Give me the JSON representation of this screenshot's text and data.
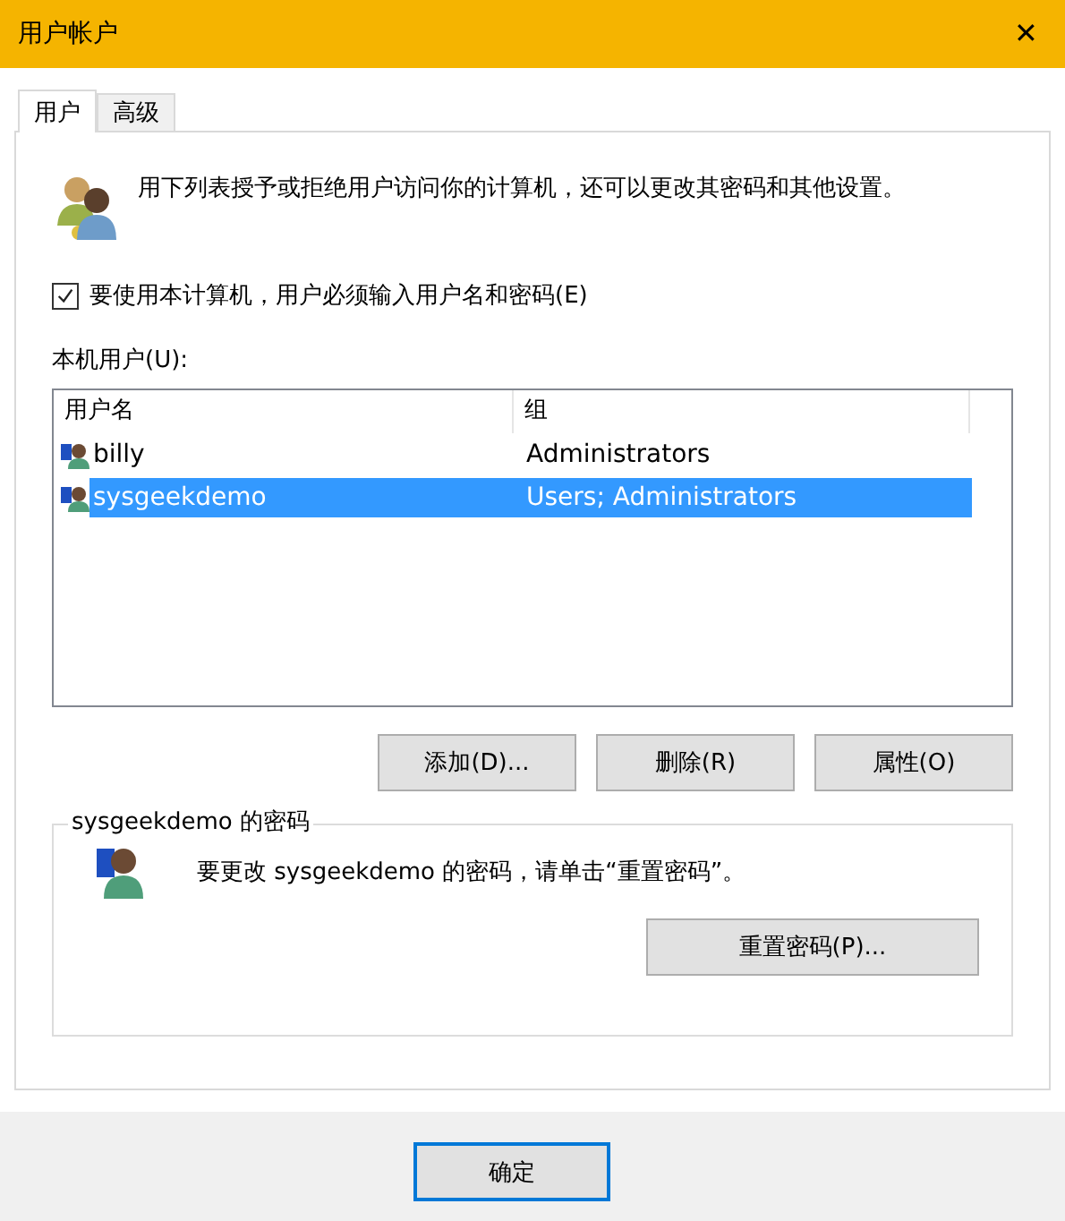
{
  "window": {
    "title": "用户帐户",
    "close": "✕"
  },
  "tabs": [
    {
      "label": "用户",
      "selected": true
    },
    {
      "label": "高级",
      "selected": false
    }
  ],
  "intro": "用下列表授予或拒绝用户访问你的计算机，还可以更改其密码和其他设置。",
  "require_login": {
    "label": "要使用本计算机，用户必须输入用户名和密码(E)",
    "checked": true
  },
  "users_label": "本机用户(U):",
  "table": {
    "columns": [
      "用户名",
      "组"
    ],
    "rows": [
      {
        "name": "billy",
        "group": "Administrators",
        "selected": false
      },
      {
        "name": "sysgeekdemo",
        "group": "Users; Administrators",
        "selected": true
      }
    ]
  },
  "user_buttons": [
    "添加(D)...",
    "删除(R)",
    "属性(O)"
  ],
  "password_group": {
    "title": "sysgeekdemo 的密码",
    "text": "要更改 sysgeekdemo 的密码，请单击“重置密码”。",
    "button": "重置密码(P)..."
  },
  "dialog_buttons": [
    "确定"
  ]
}
